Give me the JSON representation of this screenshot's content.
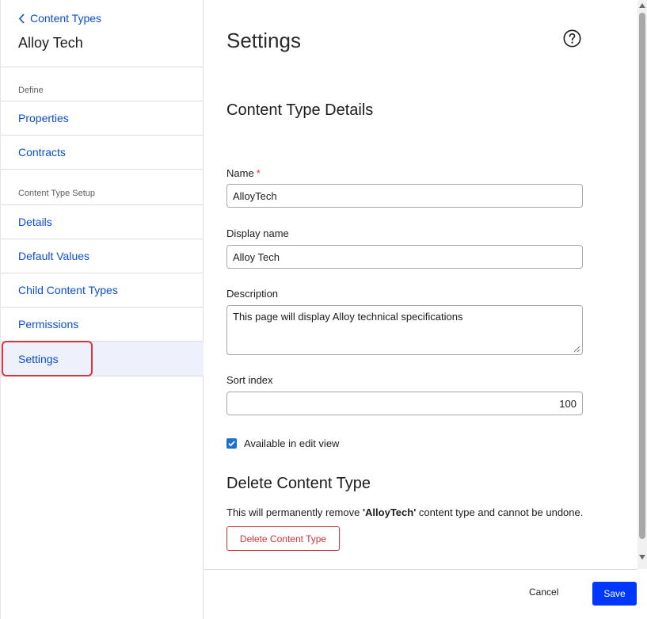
{
  "sidebar": {
    "back_label": "Content Types",
    "title": "Alloy Tech",
    "sections": [
      {
        "label": "Define",
        "items": [
          {
            "label": "Properties"
          },
          {
            "label": "Contracts"
          }
        ]
      },
      {
        "label": "Content Type Setup",
        "items": [
          {
            "label": "Details"
          },
          {
            "label": "Default Values"
          },
          {
            "label": "Child Content Types"
          },
          {
            "label": "Permissions"
          },
          {
            "label": "Settings",
            "active": true
          }
        ]
      }
    ]
  },
  "main": {
    "title": "Settings",
    "help_icon": "question-circle-icon",
    "details_heading": "Content Type Details",
    "fields": {
      "name": {
        "label": "Name",
        "required_mark": "*",
        "value": "AlloyTech"
      },
      "display_name": {
        "label": "Display name",
        "value": "Alloy Tech"
      },
      "description": {
        "label": "Description",
        "value": "This page will display Alloy technical specifications"
      },
      "sort_index": {
        "label": "Sort index",
        "value": "100"
      }
    },
    "available_in_edit_view": {
      "label": "Available in edit view",
      "checked": true
    },
    "delete_section": {
      "heading": "Delete Content Type",
      "description_prefix": "This will permanently remove ",
      "description_name": "'AlloyTech'",
      "description_suffix": " content type and cannot be undone.",
      "button_label": "Delete Content Type"
    }
  },
  "footer": {
    "cancel_label": "Cancel",
    "save_label": "Save"
  },
  "colors": {
    "link": "#0b4fd1",
    "danger": "#d0343b",
    "primary": "#0037ff",
    "active_bg": "#eef0fb",
    "highlight": "#e0343b"
  }
}
